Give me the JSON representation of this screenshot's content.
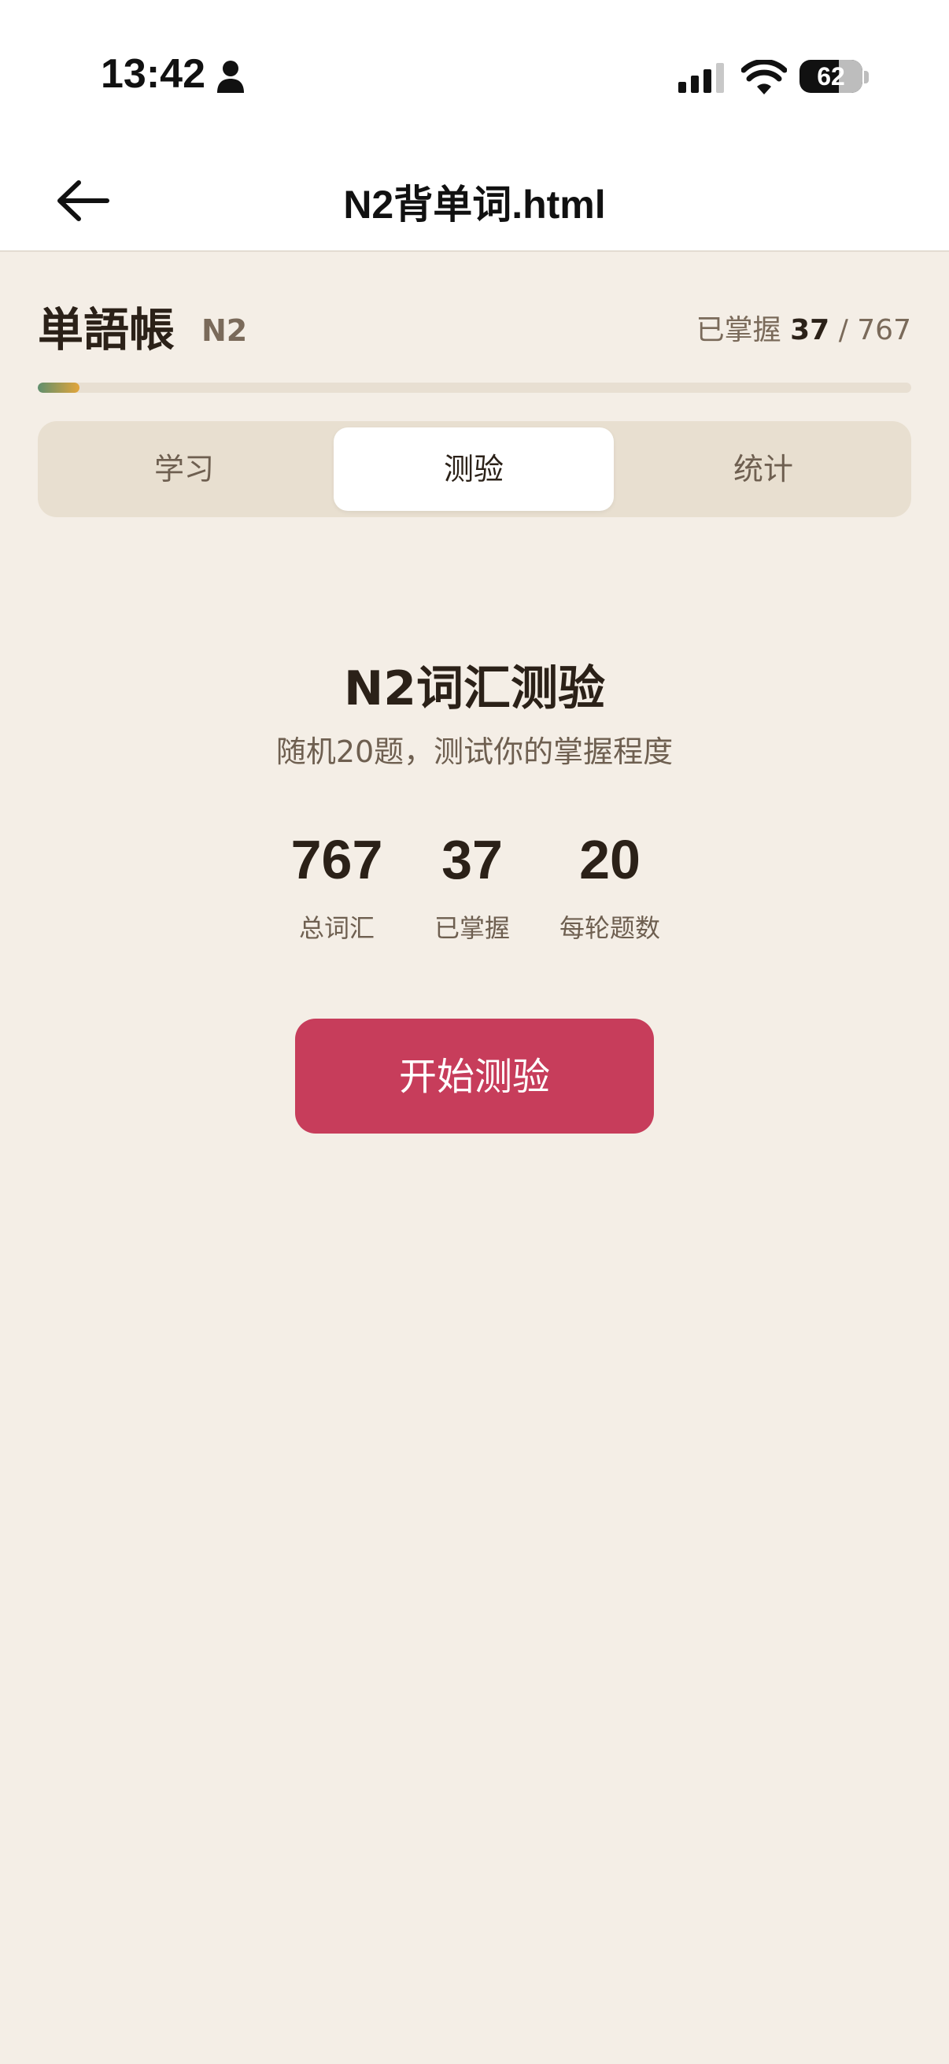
{
  "status_bar": {
    "time": "13:42",
    "battery_percent": "62"
  },
  "nav": {
    "title": "N2背单词.html"
  },
  "header": {
    "app_title": "単語帳",
    "level": "N2",
    "mastered_label": "已掌握",
    "mastered_count": "37",
    "separator": "/",
    "total_count": "767",
    "progress_fraction": 0.048
  },
  "tabs": [
    {
      "label": "学习",
      "active": false
    },
    {
      "label": "测验",
      "active": true
    },
    {
      "label": "统计",
      "active": false
    }
  ],
  "quiz": {
    "title": "N2词汇测验",
    "subtitle": "随机20题，测试你的掌握程度",
    "stats": [
      {
        "value": "767",
        "label": "总词汇"
      },
      {
        "value": "37",
        "label": "已掌握"
      },
      {
        "value": "20",
        "label": "每轮题数"
      }
    ],
    "start_button": "开始测验"
  },
  "colors": {
    "background": "#f4eee6",
    "accent": "#c73d5b",
    "progress_start": "#5f8f6e",
    "progress_end": "#e3a53b"
  }
}
